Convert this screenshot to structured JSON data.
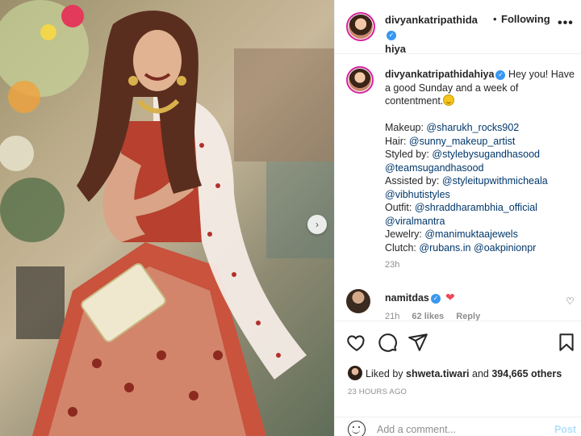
{
  "post": {
    "author": "divyankatripathidahiya",
    "author_line1": "divyankatripathida",
    "author_line2": "hiya",
    "separator": "•",
    "follow_status": "Following",
    "more_icon": "more-horizontal-icon"
  },
  "caption": {
    "username": "divyankatripathidahiya",
    "intro": "Hey you! Have a good Sunday and a week of contentment.",
    "lines": [
      {
        "label": "Makeup: ",
        "tags": [
          "@sharukh_rocks902"
        ]
      },
      {
        "label": "Hair: ",
        "tags": [
          "@sunny_makeup_artist"
        ]
      },
      {
        "label": "Styled by: ",
        "tags": [
          "@stylebysugandhasood"
        ]
      },
      {
        "label": "",
        "tags": [
          "@teamsugandhasood"
        ]
      },
      {
        "label": "Assisted by: ",
        "tags": [
          "@styleitupwithmicheala"
        ]
      },
      {
        "label": "",
        "tags": [
          "@vibhutistyles"
        ]
      },
      {
        "label": "Outfit: ",
        "tags": [
          "@shraddharambhia_official"
        ]
      },
      {
        "label": "",
        "tags": [
          "@viralmantra"
        ]
      },
      {
        "label": "Jewelry: ",
        "tags": [
          "@manimuktaajewels"
        ]
      },
      {
        "label": "Clutch: ",
        "tags": [
          "@rubans.in",
          "@oakpinionpr"
        ]
      }
    ],
    "time": "23h"
  },
  "comment": {
    "username": "namitdas",
    "text": "❤",
    "time": "21h",
    "likes": "62 likes",
    "reply": "Reply"
  },
  "actions": {
    "liked_by_prefix": "Liked by ",
    "liked_by_user": "shweta.tiwari",
    "liked_by_and": " and ",
    "liked_by_count": "394,665 others",
    "posted_ago": "23 HOURS AGO",
    "comment_placeholder": "Add a comment...",
    "post_label": "Post"
  },
  "colors": {
    "link": "#00376b",
    "verified": "#3897f0",
    "heart": "#ed4956",
    "post_disabled": "#b2dffc"
  }
}
